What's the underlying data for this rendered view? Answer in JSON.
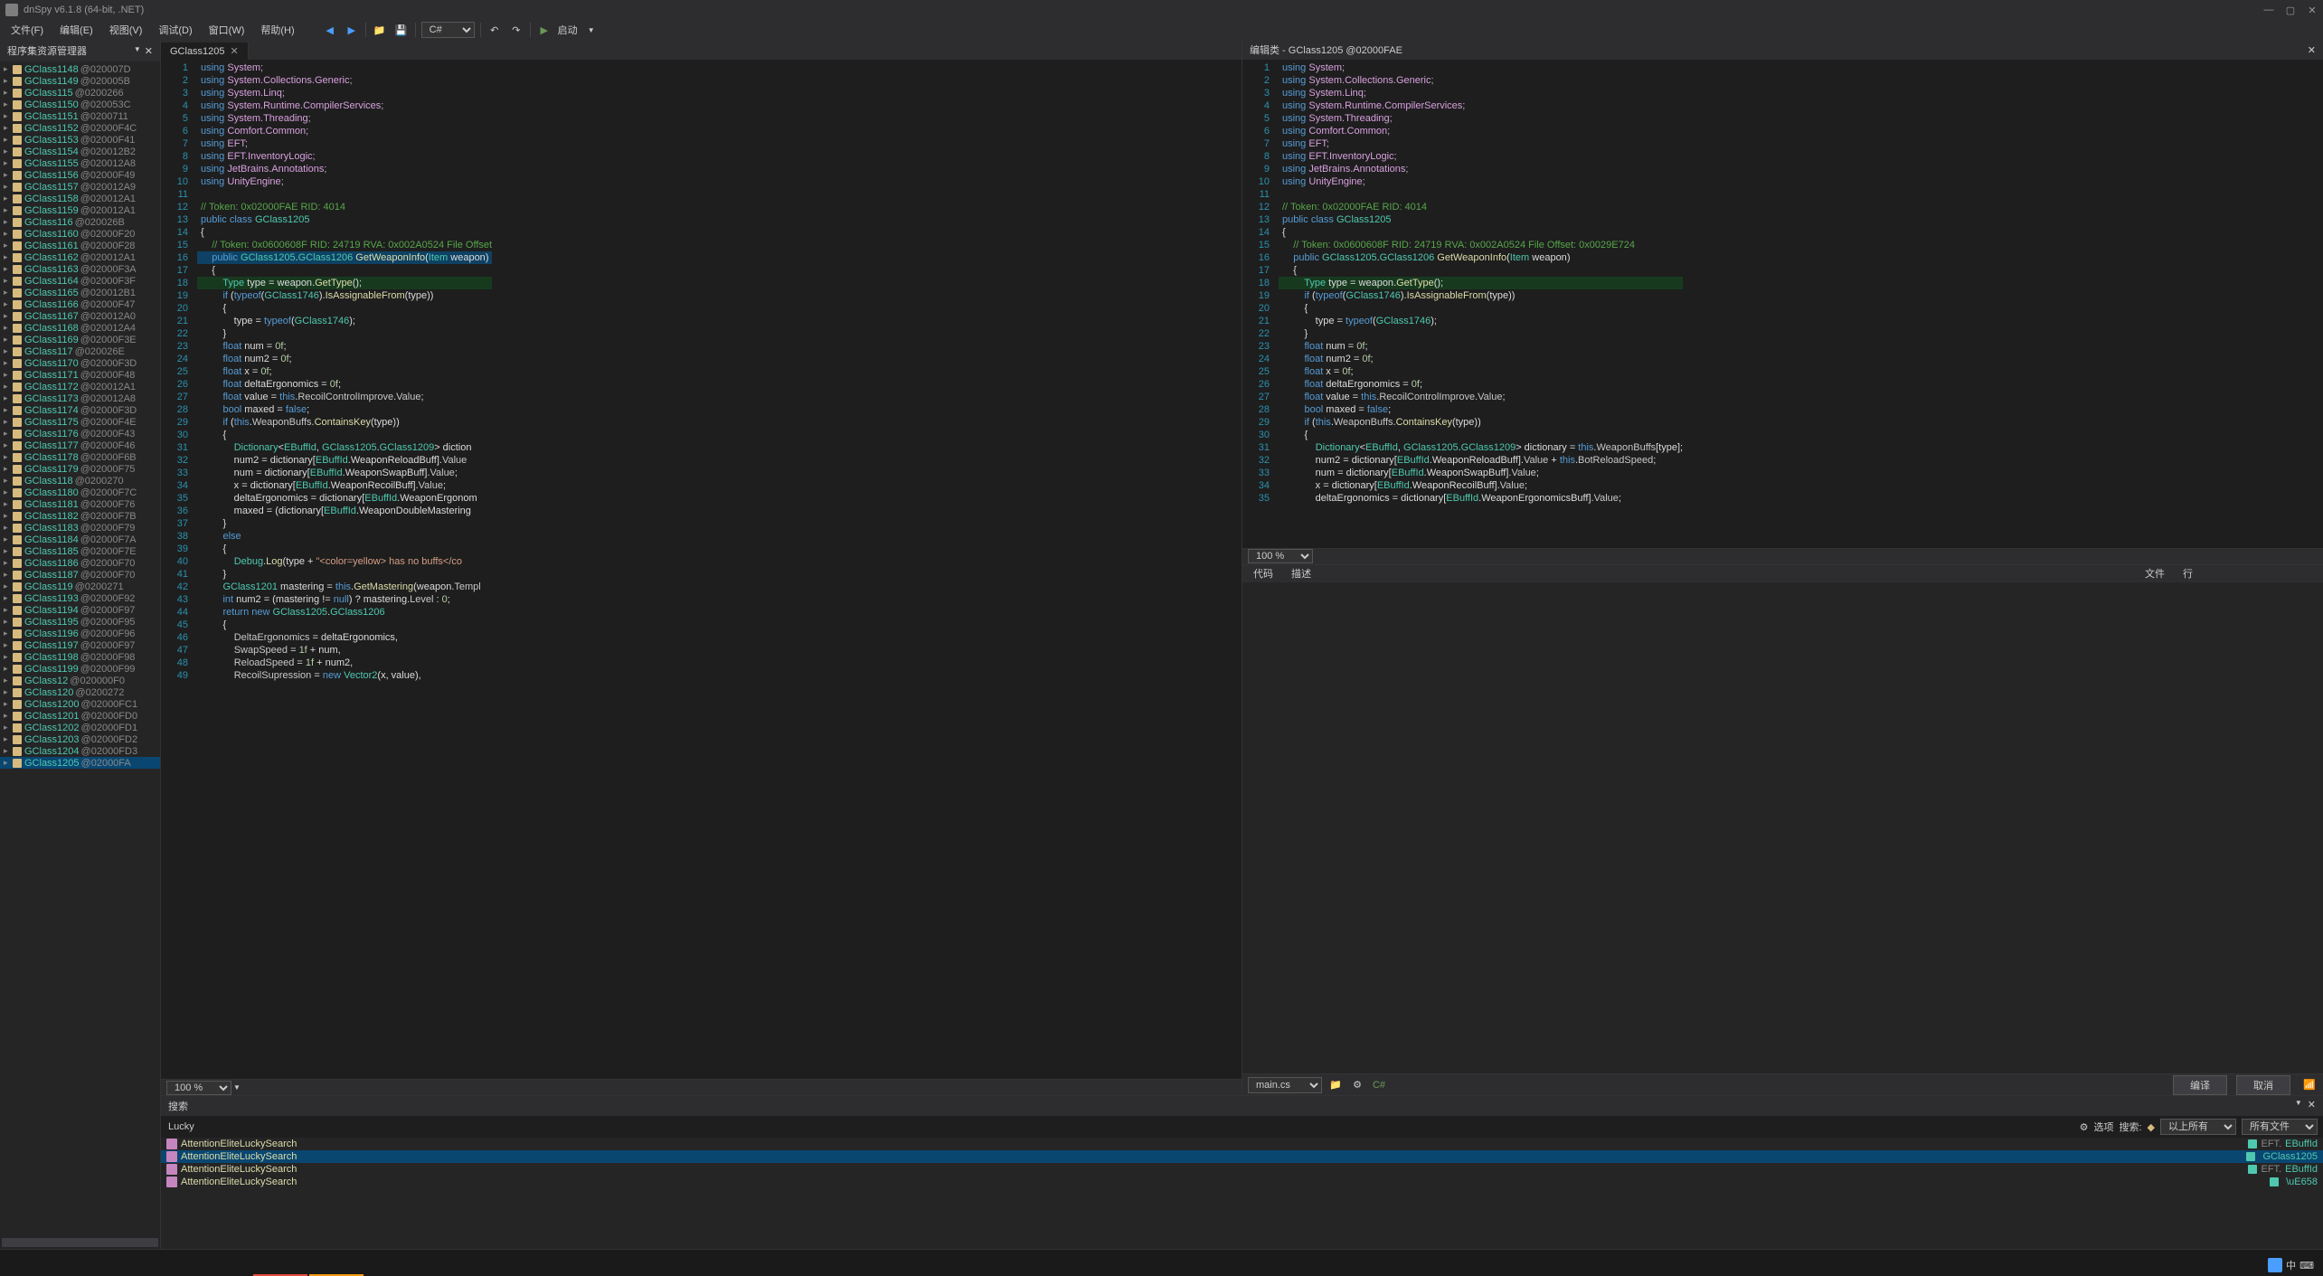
{
  "title": "dnSpy v6.1.8 (64-bit, .NET)",
  "menu": [
    "文件(F)",
    "编辑(E)",
    "视图(V)",
    "调试(D)",
    "窗口(W)",
    "帮助(H)"
  ],
  "lang": "C#",
  "run_label": "启动",
  "sidebar_title": "程序集资源管理器",
  "tree": [
    {
      "n": "GClass1148",
      "a": "@020007D"
    },
    {
      "n": "GClass1149",
      "a": "@020005B"
    },
    {
      "n": "GClass115",
      "a": "@0200266"
    },
    {
      "n": "GClass1150",
      "a": "@020053C"
    },
    {
      "n": "GClass1151",
      "a": "@0200711"
    },
    {
      "n": "GClass1152",
      "a": "@02000F4C"
    },
    {
      "n": "GClass1153",
      "a": "@02000F41"
    },
    {
      "n": "GClass1154",
      "a": "@020012B2"
    },
    {
      "n": "GClass1155",
      "a": "@020012A8"
    },
    {
      "n": "GClass1156",
      "a": "@02000F49"
    },
    {
      "n": "GClass1157",
      "a": "@020012A9"
    },
    {
      "n": "GClass1158",
      "a": "@020012A1"
    },
    {
      "n": "GClass1159",
      "a": "@020012A1"
    },
    {
      "n": "GClass116",
      "a": "@020026B"
    },
    {
      "n": "GClass1160",
      "a": "@02000F20"
    },
    {
      "n": "GClass1161",
      "a": "@02000F28"
    },
    {
      "n": "GClass1162",
      "a": "@020012A1"
    },
    {
      "n": "GClass1163",
      "a": "@02000F3A"
    },
    {
      "n": "GClass1164",
      "a": "@02000F3F"
    },
    {
      "n": "GClass1165",
      "a": "@020012B1"
    },
    {
      "n": "GClass1166",
      "a": "@02000F47"
    },
    {
      "n": "GClass1167",
      "a": "@020012A0"
    },
    {
      "n": "GClass1168",
      "a": "@020012A4"
    },
    {
      "n": "GClass1169",
      "a": "@02000F3E"
    },
    {
      "n": "GClass117",
      "a": "@020026E"
    },
    {
      "n": "GClass1170",
      "a": "@02000F3D"
    },
    {
      "n": "GClass1171",
      "a": "@02000F48"
    },
    {
      "n": "GClass1172",
      "a": "@020012A1"
    },
    {
      "n": "GClass1173",
      "a": "@020012A8"
    },
    {
      "n": "GClass1174",
      "a": "@02000F3D"
    },
    {
      "n": "GClass1175",
      "a": "@02000F4E"
    },
    {
      "n": "GClass1176",
      "a": "@02000F43"
    },
    {
      "n": "GClass1177",
      "a": "@02000F46"
    },
    {
      "n": "GClass1178",
      "a": "@02000F6B"
    },
    {
      "n": "GClass1179",
      "a": "@02000F75"
    },
    {
      "n": "GClass118",
      "a": "@0200270"
    },
    {
      "n": "GClass1180",
      "a": "@02000F7C"
    },
    {
      "n": "GClass1181",
      "a": "@02000F76"
    },
    {
      "n": "GClass1182",
      "a": "@02000F7B"
    },
    {
      "n": "GClass1183",
      "a": "@02000F79"
    },
    {
      "n": "GClass1184",
      "a": "@02000F7A"
    },
    {
      "n": "GClass1185",
      "a": "@02000F7E"
    },
    {
      "n": "GClass1186",
      "a": "@02000F70"
    },
    {
      "n": "GClass1187",
      "a": "@02000F70"
    },
    {
      "n": "GClass119",
      "a": "@0200271"
    },
    {
      "n": "GClass1193",
      "a": "@02000F92"
    },
    {
      "n": "GClass1194",
      "a": "@02000F97"
    },
    {
      "n": "GClass1195",
      "a": "@02000F95"
    },
    {
      "n": "GClass1196",
      "a": "@02000F96"
    },
    {
      "n": "GClass1197",
      "a": "@02000F97"
    },
    {
      "n": "GClass1198",
      "a": "@02000F98"
    },
    {
      "n": "GClass1199",
      "a": "@02000F99"
    },
    {
      "n": "GClass12",
      "a": "@020000F0"
    },
    {
      "n": "GClass120",
      "a": "@0200272"
    },
    {
      "n": "GClass1200",
      "a": "@02000FC1"
    },
    {
      "n": "GClass1201",
      "a": "@02000FD0"
    },
    {
      "n": "GClass1202",
      "a": "@02000FD1"
    },
    {
      "n": "GClass1203",
      "a": "@02000FD2"
    },
    {
      "n": "GClass1204",
      "a": "@02000FD3"
    },
    {
      "n": "GClass1205",
      "a": "@02000FA",
      "sel": true
    }
  ],
  "left_tab": "GClass1205",
  "right_tab": "编辑类 - GClass1205 @02000FAE",
  "zoom": "100 %",
  "right_tabs": {
    "code": "代码",
    "desc": "描述",
    "file": "文件",
    "line": "行"
  },
  "right_file": "main.cs",
  "right_btns": {
    "compile": "编译",
    "cancel": "取消"
  },
  "search_title": "搜索",
  "search_value": "Lucky",
  "search_opts": {
    "options": "选项",
    "search": "搜索:",
    "scope": "以上所有",
    "files": "所有文件"
  },
  "search_results": [
    {
      "name": "AttentionEliteLuckySearch",
      "ns": "EFT.",
      "type": "EBuffId"
    },
    {
      "name": "AttentionEliteLuckySearch",
      "ns": "",
      "type": "GClass1205",
      "sel": true
    },
    {
      "name": "AttentionEliteLuckySearch",
      "ns": "EFT.",
      "type": "EBuffId"
    },
    {
      "name": "AttentionEliteLuckySearch",
      "ns": "",
      "type": "\\uE658"
    }
  ],
  "code_left_lines": 49,
  "code_right_lines": 35
}
